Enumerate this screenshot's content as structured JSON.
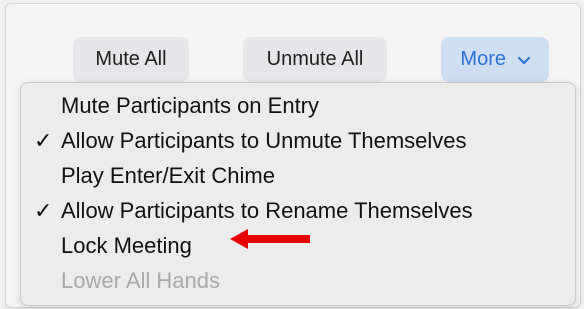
{
  "toolbar": {
    "mute_all_label": "Mute All",
    "unmute_all_label": "Unmute All",
    "more_label": "More"
  },
  "menu": {
    "items": [
      {
        "label": "Mute Participants on Entry",
        "checked": false,
        "enabled": true
      },
      {
        "label": "Allow Participants to Unmute Themselves",
        "checked": true,
        "enabled": true
      },
      {
        "label": "Play Enter/Exit Chime",
        "checked": false,
        "enabled": true
      },
      {
        "label": "Allow Participants to Rename Themselves",
        "checked": true,
        "enabled": true
      },
      {
        "label": "Lock Meeting",
        "checked": false,
        "enabled": true
      },
      {
        "label": "Lower All Hands",
        "checked": false,
        "enabled": false
      }
    ],
    "check_glyph": "✓"
  },
  "icons": {
    "more_chevron": "chevron-down-icon",
    "annotation_arrow": "red-arrow-icon"
  },
  "colors": {
    "accent": "#2b73d8",
    "more_button_bg": "#cfdff3",
    "annotation_arrow": "#e60000",
    "disabled_text": "#a9a9a9"
  }
}
